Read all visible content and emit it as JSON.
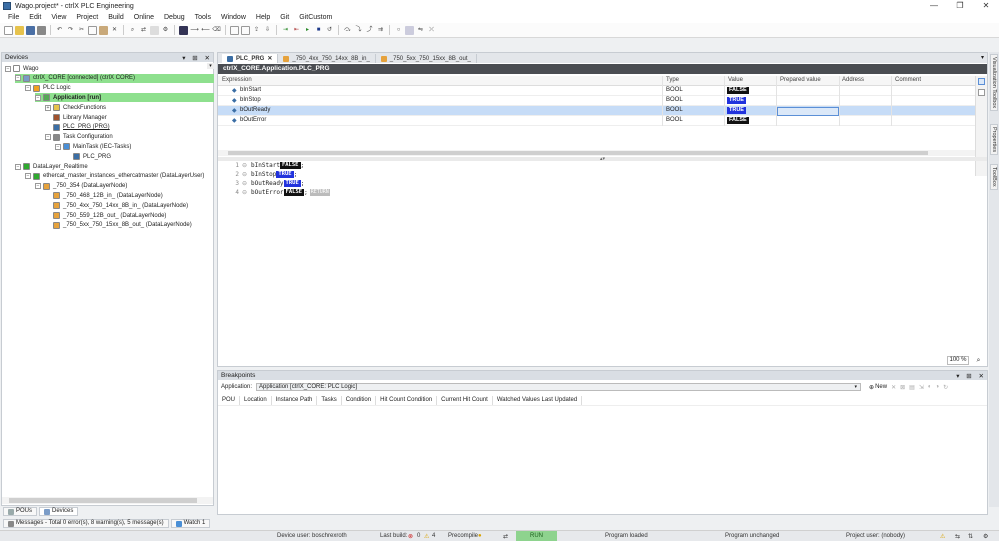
{
  "window": {
    "title": "Wago.project* - ctrlX PLC Engineering",
    "minimize": "—",
    "maximize": "❐",
    "close": "✕"
  },
  "menu": [
    "File",
    "Edit",
    "View",
    "Project",
    "Build",
    "Online",
    "Debug",
    "Tools",
    "Window",
    "Help",
    "Git",
    "GitCustom"
  ],
  "devices_panel": {
    "title": "Devices",
    "controls": {
      "dropdown": "▾",
      "pin": "⊞",
      "close": "✕"
    },
    "tree": [
      {
        "label": "Wago",
        "indent": 0,
        "exp": "−",
        "icon": "project-icon",
        "color": "#ffffff",
        "hl": false,
        "bold": false
      },
      {
        "label": "ctrlX_CORE [connected] (ctrlX CORE)",
        "indent": 1,
        "exp": "−",
        "icon": "device-icon",
        "color": "#7b9cc7",
        "hl": true,
        "bold": false
      },
      {
        "label": "PLC Logic",
        "indent": 2,
        "exp": "−",
        "icon": "plc-logic-icon",
        "color": "#f0a020",
        "hl": false,
        "bold": false
      },
      {
        "label": "Application [run]",
        "indent": 3,
        "exp": "−",
        "icon": "application-icon",
        "color": "#55aa55",
        "hl": true,
        "bold": true
      },
      {
        "label": "CheckFunctions",
        "indent": 4,
        "exp": "+",
        "icon": "folder-icon",
        "color": "#e6c24c",
        "hl": false,
        "bold": false
      },
      {
        "label": "Library Manager",
        "indent": 4,
        "exp": "",
        "icon": "library-icon",
        "color": "#a0522d",
        "hl": false,
        "bold": false
      },
      {
        "label": "PLC_PRG (PRG)",
        "indent": 4,
        "exp": "",
        "icon": "pou-icon",
        "color": "#3b6ea5",
        "hl": false,
        "bold": false,
        "underline": true
      },
      {
        "label": "Task Configuration",
        "indent": 4,
        "exp": "−",
        "icon": "task-config-icon",
        "color": "#888888",
        "hl": false,
        "bold": false
      },
      {
        "label": "MainTask (IEC-Tasks)",
        "indent": 5,
        "exp": "−",
        "icon": "task-icon",
        "color": "#4a8fd6",
        "hl": false,
        "bold": false
      },
      {
        "label": "PLC_PRG",
        "indent": 6,
        "exp": "",
        "icon": "call-icon",
        "color": "#3b6ea5",
        "hl": false,
        "bold": false
      },
      {
        "label": "DataLayer_Realtime",
        "indent": 1,
        "exp": "−",
        "icon": "datalayer-icon",
        "color": "#2fa92f",
        "hl": false,
        "bold": false
      },
      {
        "label": "ethercat_master_instances_ethercatmaster (DataLayerUser)",
        "indent": 2,
        "exp": "−",
        "icon": "ethercat-icon",
        "color": "#2fa92f",
        "hl": false,
        "bold": false
      },
      {
        "label": "_750_354 (DataLayerNode)",
        "indent": 3,
        "exp": "−",
        "icon": "node-icon",
        "color": "#e6a23c",
        "hl": false,
        "bold": false
      },
      {
        "label": "_750_468_12B_in_ (DataLayerNode)",
        "indent": 4,
        "exp": "",
        "icon": "node-icon",
        "color": "#e6a23c",
        "hl": false,
        "bold": false
      },
      {
        "label": "_750_4xx_750_14xx_8B_in_ (DataLayerNode)",
        "indent": 4,
        "exp": "",
        "icon": "node-icon",
        "color": "#e6a23c",
        "hl": false,
        "bold": false
      },
      {
        "label": "_750_559_12B_out_ (DataLayerNode)",
        "indent": 4,
        "exp": "",
        "icon": "node-icon",
        "color": "#e6a23c",
        "hl": false,
        "bold": false
      },
      {
        "label": "_750_5xx_750_15xx_8B_out_ (DataLayerNode)",
        "indent": 4,
        "exp": "",
        "icon": "node-icon",
        "color": "#e6a23c",
        "hl": false,
        "bold": false
      }
    ],
    "bottom_tabs": [
      "POUs",
      "Devices"
    ]
  },
  "editor": {
    "tabs": [
      {
        "label": "PLC_PRG",
        "active": true,
        "close": "✕"
      },
      {
        "label": "_750_4xx_750_14xx_8B_in_",
        "active": false,
        "close": ""
      },
      {
        "label": "_750_5xx_750_15xx_8B_out_",
        "active": false,
        "close": ""
      }
    ],
    "tab_dropdown": "▾",
    "path": "ctrlX_CORE.Application.PLC_PRG",
    "watch_columns": [
      "Expression",
      "Type",
      "Value",
      "Prepared value",
      "Address",
      "Comment"
    ],
    "watch_rows": [
      {
        "expr": "bInStart",
        "type": "BOOL",
        "value": "FALSE",
        "selected": false
      },
      {
        "expr": "bInStop",
        "type": "BOOL",
        "value": "TRUE",
        "selected": false
      },
      {
        "expr": "bOutReady",
        "type": "BOOL",
        "value": "TRUE",
        "selected": true
      },
      {
        "expr": "bOutError",
        "type": "BOOL",
        "value": "FALSE",
        "selected": false
      }
    ],
    "code_lines": [
      {
        "num": "1",
        "text": "bInStart",
        "val": "FALSE",
        "tail": ";",
        "extra": ""
      },
      {
        "num": "2",
        "text": "bInStop",
        "val": "TRUE",
        "tail": ";",
        "extra": ""
      },
      {
        "num": "3",
        "text": "bOutReady",
        "val": "TRUE",
        "tail": ";",
        "extra": ""
      },
      {
        "num": "4",
        "text": "bOutError",
        "val": "FALSE",
        "tail": ";",
        "extra": "RETURN"
      }
    ],
    "zoom": "100 %"
  },
  "breakpoints": {
    "title": "Breakpoints",
    "app_label": "Application:",
    "app_value": "Application [ctrlX_CORE: PLC Logic]",
    "new_label": "New",
    "columns": [
      "POU",
      "Location",
      "Instance Path",
      "Tasks",
      "Condition",
      "Hit Count Condition",
      "Current Hit Count",
      "Watched Values Last Updated"
    ]
  },
  "right_sidebar": [
    "Visualization Toolbox",
    "Properties",
    "ToolBox"
  ],
  "message_tabs": [
    "Messages - Total 0 error(s), 8 warning(s), 5 message(s)",
    "Watch 1"
  ],
  "status": {
    "device_user": "Device user: boschrexroth",
    "last_build": "Last build:",
    "errors": "0",
    "warnings": "4",
    "precompile": "Precompile",
    "run": "RUN",
    "program_loaded": "Program loaded",
    "program_unchanged": "Program unchanged",
    "project_user": "Project user: (nobody)"
  },
  "colors": {
    "accent_green": "#8ee08e",
    "false_bg": "#111111",
    "true_bg": "#2233dd",
    "path_bar": "#4a4d52"
  }
}
